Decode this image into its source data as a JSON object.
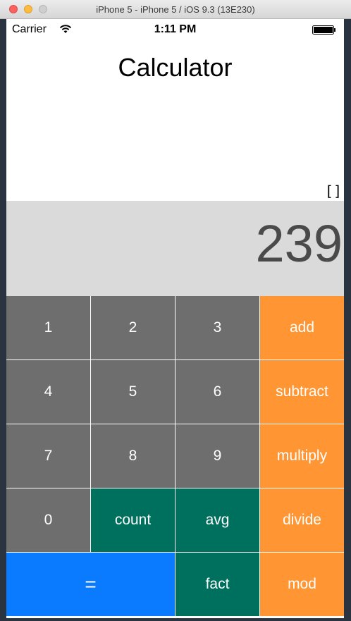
{
  "window": {
    "title": "iPhone 5 - iPhone 5 / iOS 9.3 (13E230)"
  },
  "status_bar": {
    "carrier": "Carrier",
    "time": "1:11 PM"
  },
  "app": {
    "title": "Calculator",
    "history": "[]",
    "display": "239"
  },
  "keys": {
    "k1": "1",
    "k2": "2",
    "k3": "3",
    "add": "add",
    "k4": "4",
    "k5": "5",
    "k6": "6",
    "subtract": "subtract",
    "k7": "7",
    "k8": "8",
    "k9": "9",
    "multiply": "multiply",
    "k0": "0",
    "count": "count",
    "avg": "avg",
    "divide": "divide",
    "equals": "=",
    "fact": "fact",
    "mod": "mod"
  },
  "colors": {
    "number_key": "#6e6e6e",
    "operator_key": "#ff9633",
    "function_key": "#00705e",
    "equals_key": "#0a7aff",
    "display_bg": "#dadada"
  },
  "icons": {
    "wifi": "wifi-icon",
    "battery": "battery-icon",
    "close": "close-icon",
    "minimize": "minimize-icon",
    "zoom": "zoom-icon"
  }
}
